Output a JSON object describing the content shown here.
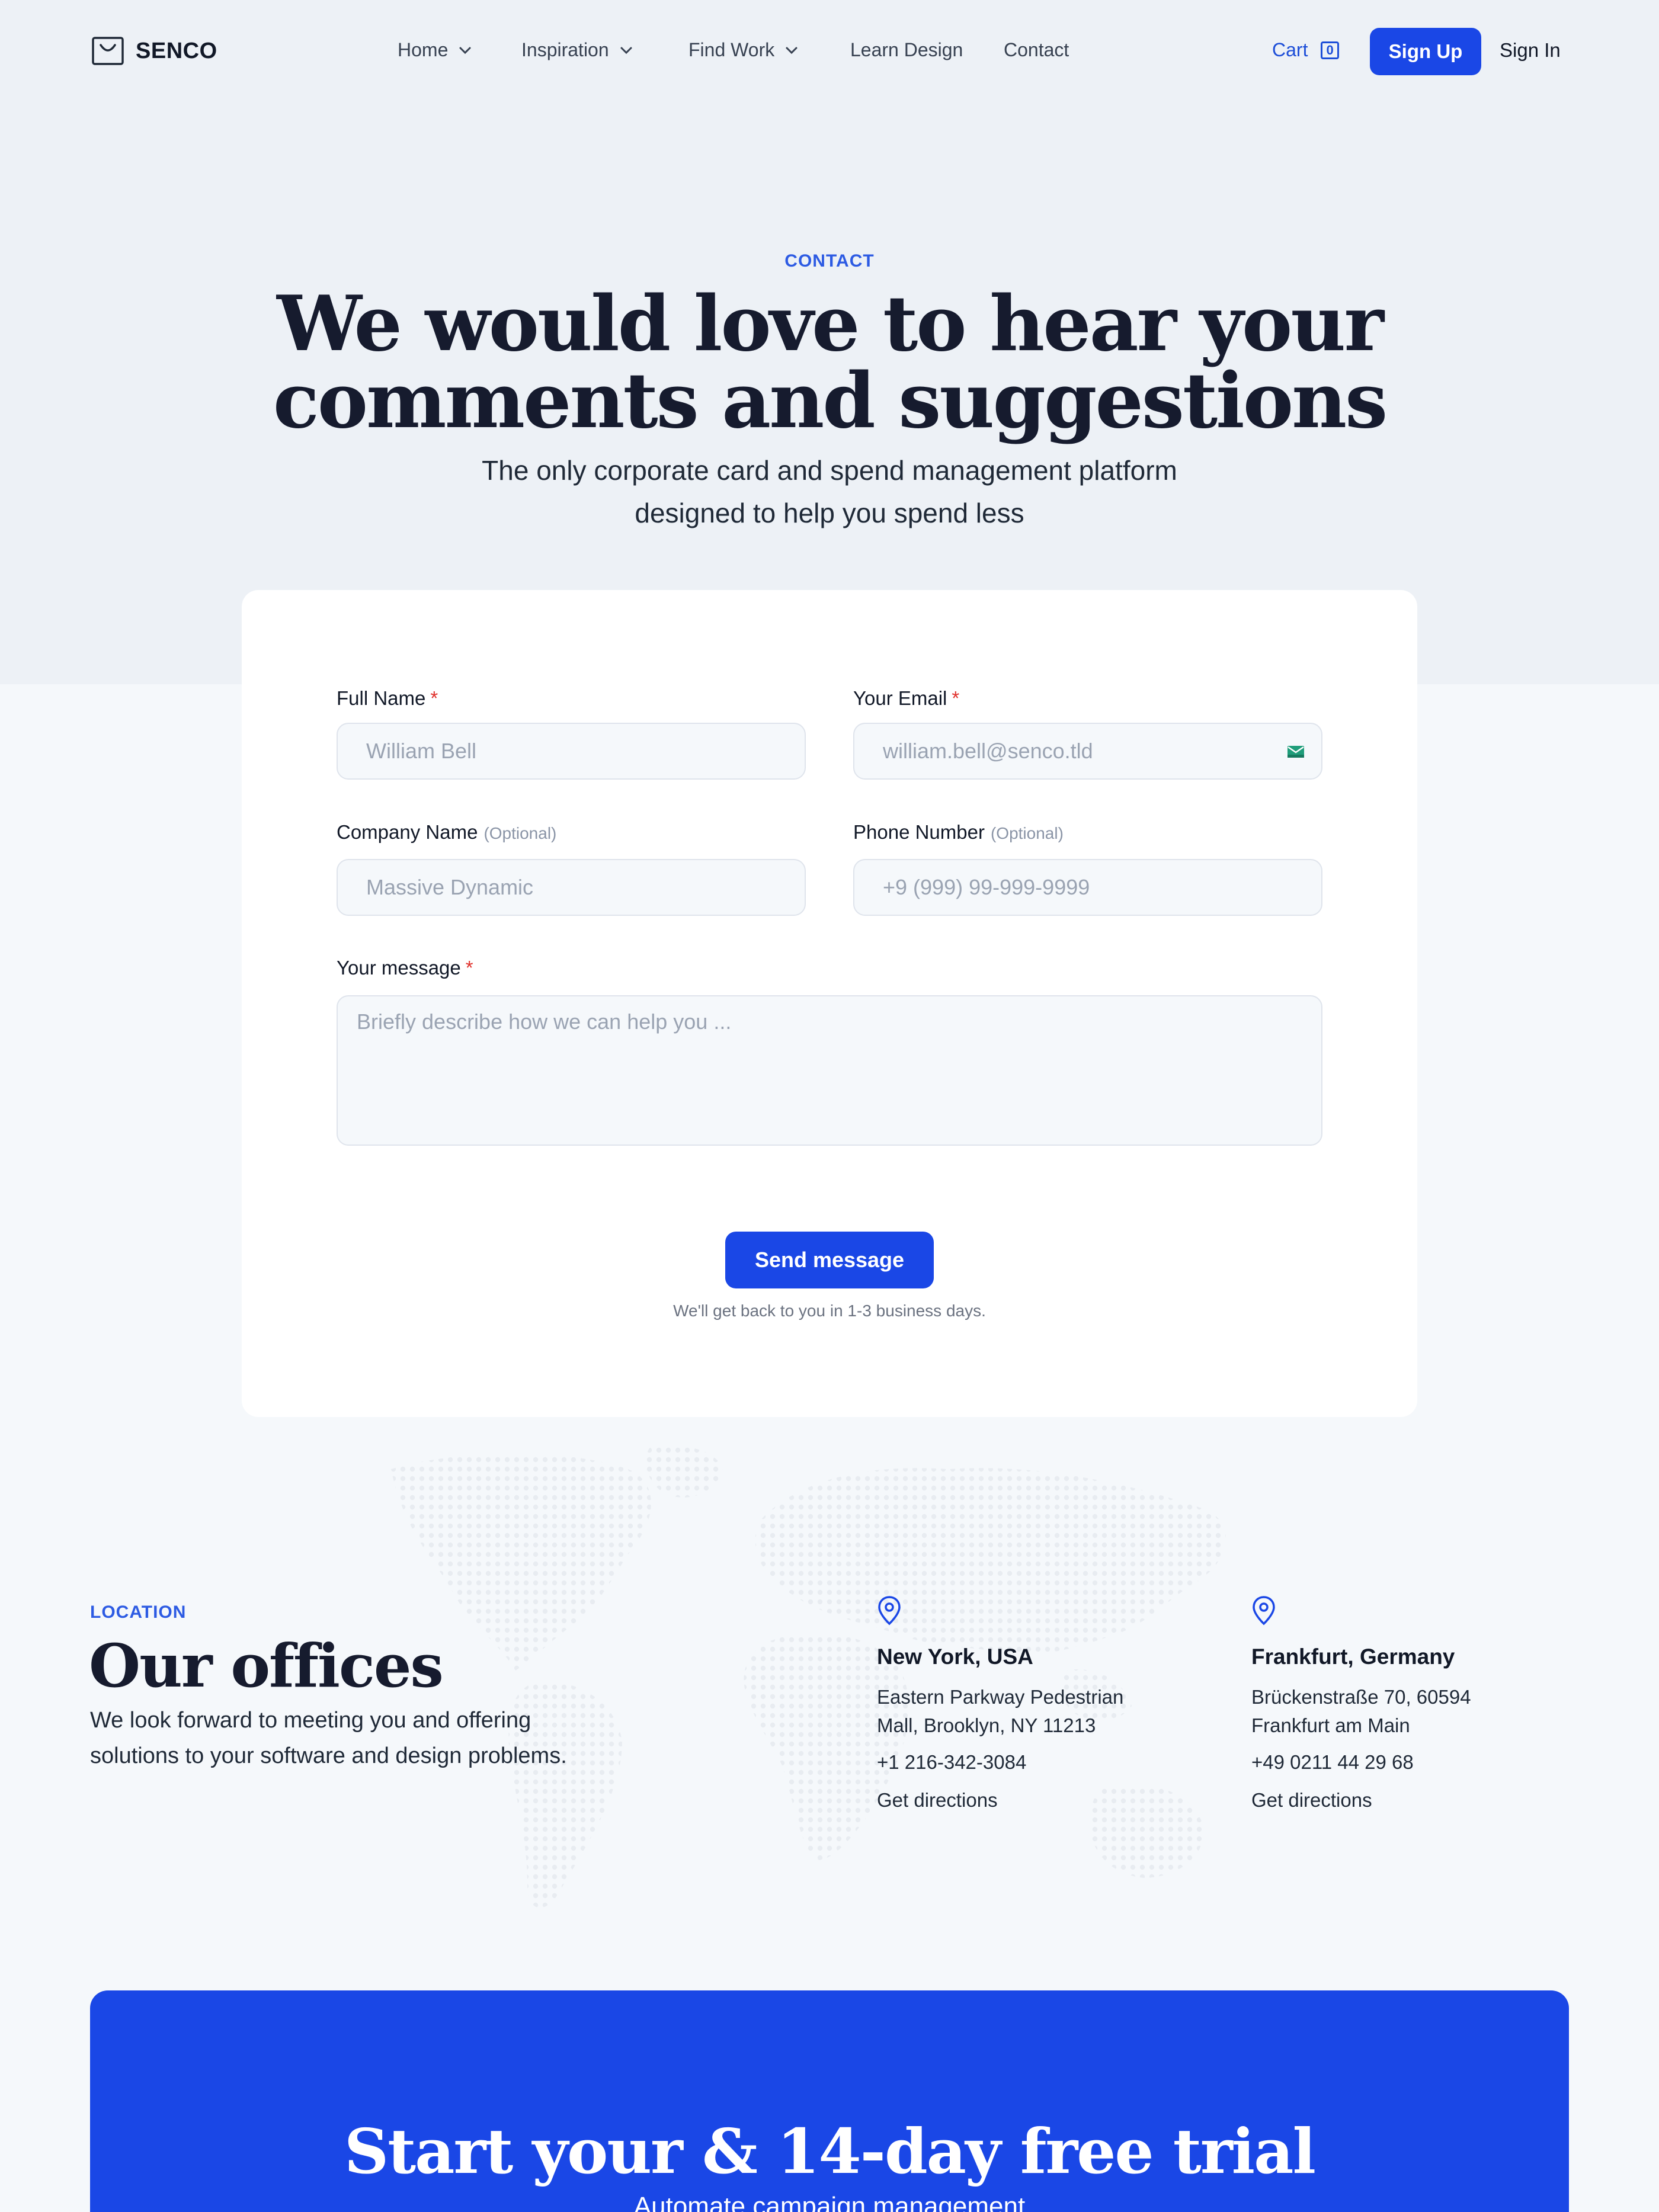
{
  "brand": {
    "name": "SENCO",
    "icon": "shopping-bag-icon"
  },
  "nav": {
    "items": [
      {
        "label": "Home",
        "dropdown": true
      },
      {
        "label": "Inspiration",
        "dropdown": true
      },
      {
        "label": "Find Work",
        "dropdown": true
      },
      {
        "label": "Learn Design",
        "dropdown": false
      },
      {
        "label": "Contact",
        "dropdown": false
      }
    ],
    "cart_label": "Cart",
    "cart_count": "0",
    "signup_label": "Sign Up",
    "signin_label": "Sign In"
  },
  "hero": {
    "eyebrow": "CONTACT",
    "title_line1": "We would love to hear your",
    "title_line2": "comments and suggestions",
    "subtitle_line1": "The only corporate card and spend management platform",
    "subtitle_line2": "designed to help you spend less"
  },
  "form": {
    "full_name": {
      "label": "Full Name",
      "required": "*",
      "placeholder": "William Bell"
    },
    "email": {
      "label": "Your Email",
      "required": "*",
      "placeholder": "william.bell@senco.tld",
      "icon": "mail-icon"
    },
    "company": {
      "label": "Company Name",
      "optional": "(Optional)",
      "placeholder": "Massive Dynamic"
    },
    "phone": {
      "label": "Phone Number",
      "optional": "(Optional)",
      "placeholder": "+9 (999) 99-999-9999"
    },
    "message": {
      "label": "Your message",
      "required": "*",
      "placeholder": "Briefly describe how we can help you ..."
    },
    "submit_label": "Send message",
    "note": "We'll get back to you in 1-3 business days."
  },
  "offices": {
    "eyebrow": "LOCATION",
    "title": "Our offices",
    "subtitle": "We look forward to meeting you and offering solutions to your software and design problems.",
    "list": [
      {
        "city": "New York, USA",
        "address_line1": "Eastern Parkway Pedestrian",
        "address_line2": "Mall, Brooklyn, NY 11213",
        "phone": "+1 216-342-3084",
        "directions": "Get directions",
        "icon": "map-pin-icon"
      },
      {
        "city": "Frankfurt, Germany",
        "address_line1": "Brückenstraße 70, 60594",
        "address_line2": "Frankfurt am Main",
        "phone": "+49 0211 44 29 68",
        "directions": "Get directions",
        "icon": "map-pin-icon"
      }
    ]
  },
  "cta": {
    "title": "Start your & 14-day free trial",
    "subtitle": "Automate campaign management"
  },
  "colors": {
    "accent": "#1a47e6",
    "accent_text": "#2d5be3",
    "hero_bg": "#edf1f6",
    "page_bg": "#f5f8fb",
    "required": "#e0312c"
  }
}
